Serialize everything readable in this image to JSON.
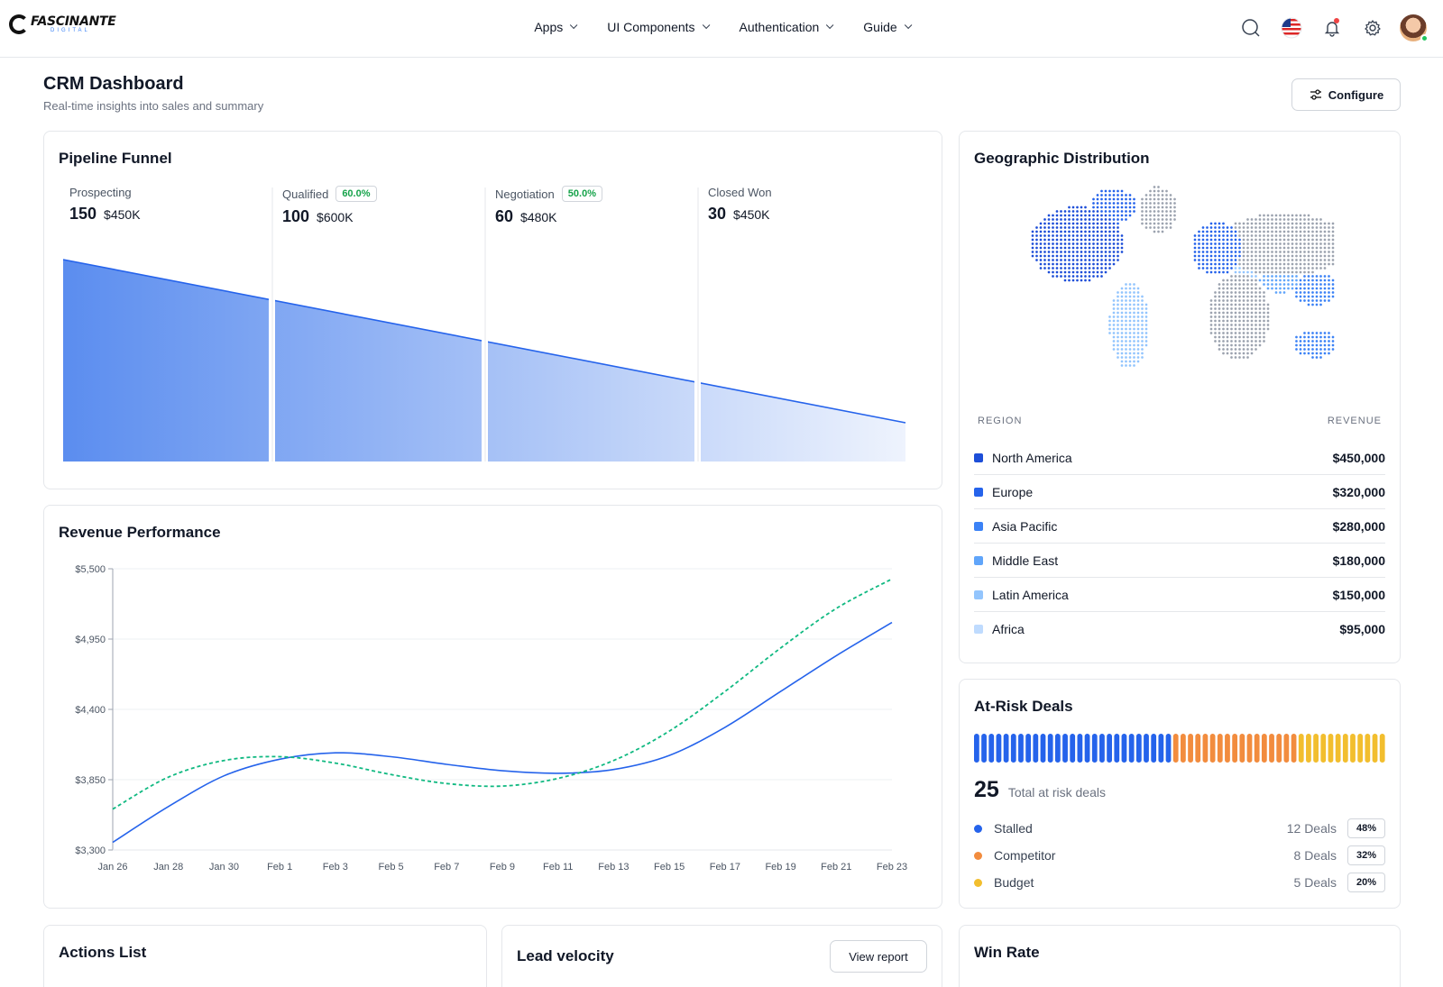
{
  "brand": {
    "name": "FASCINANTE",
    "tagline": "DIGITAL"
  },
  "nav": {
    "items": [
      "Apps",
      "UI Components",
      "Authentication",
      "Guide"
    ]
  },
  "topbar_icons": [
    "search-icon",
    "us-flag-icon",
    "bell-icon",
    "gear-icon",
    "avatar"
  ],
  "header": {
    "title": "CRM Dashboard",
    "subtitle": "Real-time insights into sales and summary",
    "configure_label": "Configure"
  },
  "pipeline": {
    "title": "Pipeline Funnel",
    "stages": [
      {
        "name": "Prospecting",
        "badge": "",
        "count": "150",
        "amount": "$450K"
      },
      {
        "name": "Qualified",
        "badge": "60.0%",
        "count": "100",
        "amount": "$600K"
      },
      {
        "name": "Negotiation",
        "badge": "50.0%",
        "count": "60",
        "amount": "$480K"
      },
      {
        "name": "Closed Won",
        "badge": "",
        "count": "30",
        "amount": "$450K"
      }
    ]
  },
  "geo": {
    "title": "Geographic Distribution",
    "col_region": "REGION",
    "col_revenue": "REVENUE",
    "rows": [
      {
        "region": "North America",
        "revenue": "$450,000",
        "color": "#1d4ed8"
      },
      {
        "region": "Europe",
        "revenue": "$320,000",
        "color": "#2563eb"
      },
      {
        "region": "Asia Pacific",
        "revenue": "$280,000",
        "color": "#3b82f6"
      },
      {
        "region": "Middle East",
        "revenue": "$180,000",
        "color": "#60a5fa"
      },
      {
        "region": "Latin America",
        "revenue": "$150,000",
        "color": "#93c5fd"
      },
      {
        "region": "Africa",
        "revenue": "$95,000",
        "color": "#bfdbfe"
      }
    ]
  },
  "revenue": {
    "title": "Revenue Performance",
    "y_ticks": [
      "$5,500",
      "$4,950",
      "$4,400",
      "$3,850",
      "$3,300"
    ],
    "x_ticks": [
      "Jan 26",
      "Jan 28",
      "Jan 30",
      "Feb 1",
      "Feb 3",
      "Feb 5",
      "Feb 7",
      "Feb 9",
      "Feb 11",
      "Feb 13",
      "Feb 15",
      "Feb 17",
      "Feb 19",
      "Feb 21",
      "Feb 23"
    ]
  },
  "chart_data": {
    "type": "line",
    "title": "Revenue Performance",
    "x": [
      "Jan 26",
      "Jan 28",
      "Jan 30",
      "Feb 1",
      "Feb 3",
      "Feb 5",
      "Feb 7",
      "Feb 9",
      "Feb 11",
      "Feb 13",
      "Feb 15",
      "Feb 17",
      "Feb 19",
      "Feb 21",
      "Feb 23"
    ],
    "ylim": [
      3300,
      5500
    ],
    "series": [
      {
        "style": "solid",
        "color": "#2563eb",
        "values": [
          3360,
          3640,
          3880,
          4010,
          4060,
          4030,
          3970,
          3920,
          3900,
          3930,
          4040,
          4260,
          4540,
          4820,
          5080
        ]
      },
      {
        "style": "dashed",
        "color": "#10b981",
        "values": [
          3620,
          3870,
          4000,
          4030,
          3980,
          3890,
          3820,
          3800,
          3860,
          4000,
          4230,
          4540,
          4880,
          5190,
          5420
        ]
      }
    ],
    "grid": true
  },
  "risk": {
    "title": "At-Risk Deals",
    "total": "25",
    "total_label": "Total at risk deals",
    "bar_counts": {
      "blue": 27,
      "orange": 17,
      "yellow": 12
    },
    "items": [
      {
        "label": "Stalled",
        "deals": "12 Deals",
        "pct": "48%",
        "color": "#2563eb"
      },
      {
        "label": "Competitor",
        "deals": "8 Deals",
        "pct": "32%",
        "color": "#f28c3e"
      },
      {
        "label": "Budget",
        "deals": "5 Deals",
        "pct": "20%",
        "color": "#f2be2e"
      }
    ]
  },
  "actions": {
    "title": "Actions List"
  },
  "velocity": {
    "title": "Lead velocity",
    "view_report": "View report"
  },
  "winrate": {
    "title": "Win Rate"
  }
}
